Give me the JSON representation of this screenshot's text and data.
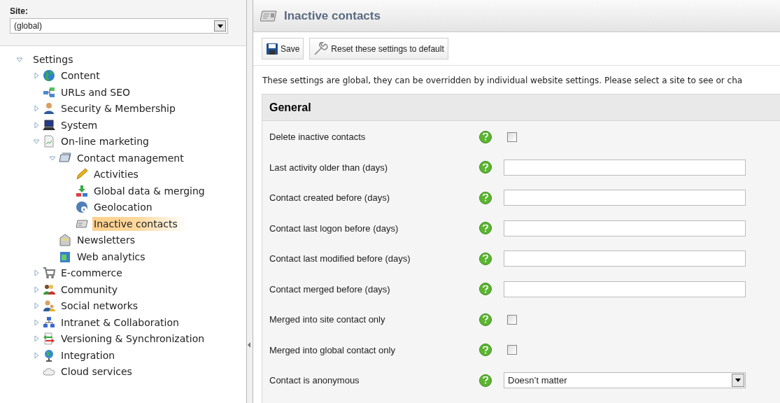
{
  "site_selector": {
    "label": "Site:",
    "value": "(global)"
  },
  "tree": [
    {
      "label": "Settings",
      "expanded": true,
      "selected": false,
      "children": [
        {
          "label": "Content",
          "expanded": false,
          "selected": false
        },
        {
          "label": "URLs and SEO",
          "selected": false
        },
        {
          "label": "Security & Membership",
          "expanded": false,
          "selected": false
        },
        {
          "label": "System",
          "expanded": false,
          "selected": false
        },
        {
          "label": "On-line marketing",
          "expanded": true,
          "selected": false,
          "children": [
            {
              "label": "Contact management",
              "expanded": true,
              "selected": false,
              "children": [
                {
                  "label": "Activities",
                  "selected": false
                },
                {
                  "label": "Global data & merging",
                  "selected": false
                },
                {
                  "label": "Geolocation",
                  "selected": false
                },
                {
                  "label": "Inactive contacts",
                  "selected": true
                }
              ]
            },
            {
              "label": "Newsletters",
              "selected": false
            },
            {
              "label": "Web analytics",
              "selected": false
            }
          ]
        },
        {
          "label": "E-commerce",
          "expanded": false,
          "selected": false
        },
        {
          "label": "Community",
          "expanded": false,
          "selected": false
        },
        {
          "label": "Social networks",
          "expanded": false,
          "selected": false
        },
        {
          "label": "Intranet & Collaboration",
          "expanded": false,
          "selected": false
        },
        {
          "label": "Versioning & Synchronization",
          "expanded": false,
          "selected": false
        },
        {
          "label": "Integration",
          "expanded": false,
          "selected": false
        },
        {
          "label": "Cloud services",
          "selected": false
        }
      ]
    }
  ],
  "page": {
    "title": "Inactive contacts",
    "toolbar": [
      "Save",
      "Reset these settings to default"
    ],
    "info": "These settings are global, they can be overridden by individual website settings. Please select a site to see or cha",
    "section": {
      "title": "General",
      "rows": [
        {
          "kind": "checkbox",
          "label": "Delete inactive contacts",
          "checked": false
        },
        {
          "kind": "text",
          "label": "Last activity older than (days)"
        },
        {
          "kind": "text",
          "label": "Contact created before (days)"
        },
        {
          "kind": "text",
          "label": "Contact last logon before (days)"
        },
        {
          "kind": "text",
          "label": "Contact last modified before (days)"
        },
        {
          "kind": "text",
          "label": "Contact merged before (days)"
        },
        {
          "kind": "checkbox",
          "label": "Merged into site contact only",
          "checked": false
        },
        {
          "kind": "checkbox",
          "label": "Merged into global contact only",
          "checked": false
        },
        {
          "kind": "select",
          "label": "Contact is anonymous",
          "value": "Doesn’t matter"
        }
      ]
    }
  }
}
